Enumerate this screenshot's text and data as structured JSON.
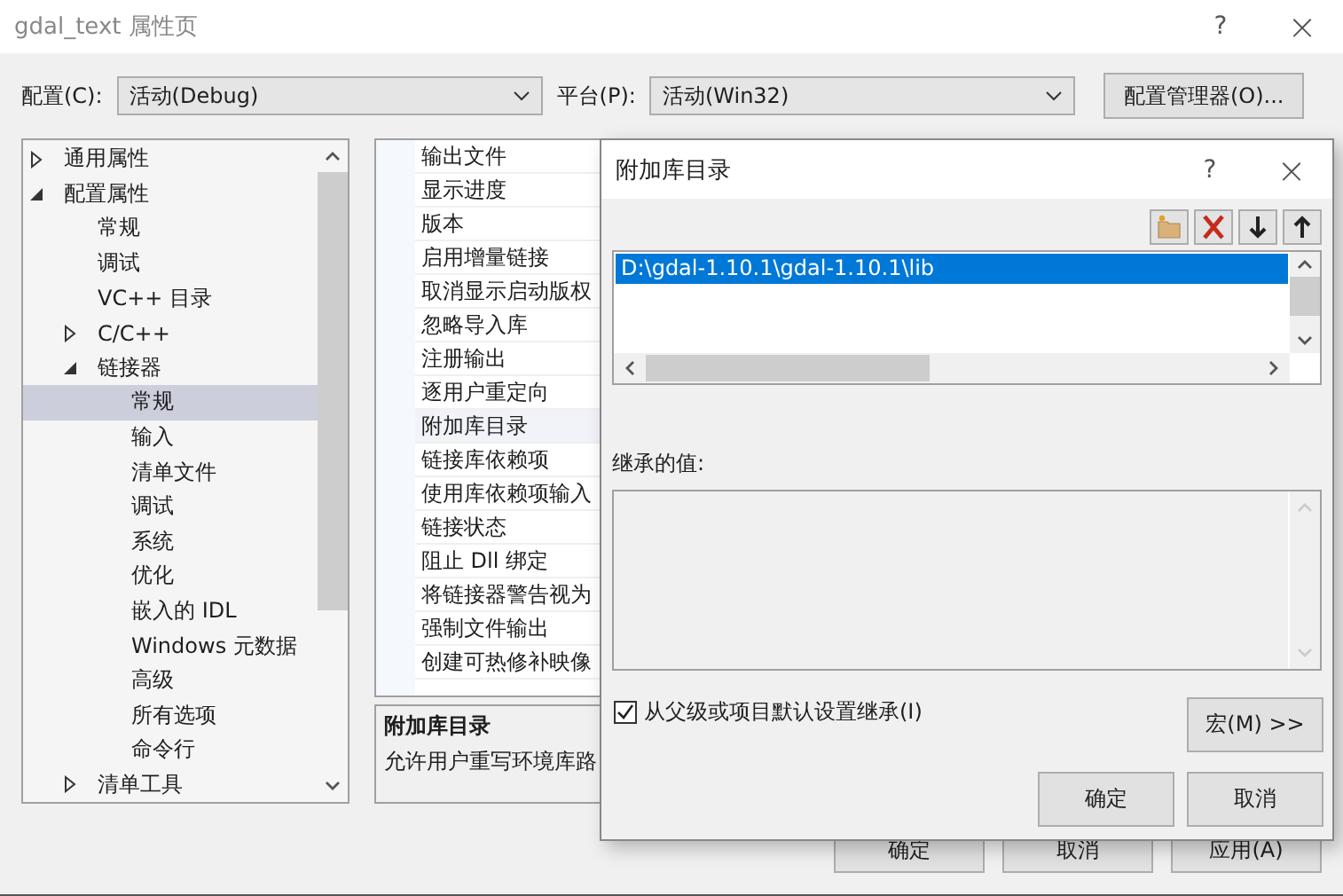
{
  "window": {
    "title": "gdal_text 属性页",
    "help": "?",
    "close": "×"
  },
  "toolbar": {
    "config_label": "配置(C):",
    "config_value": "活动(Debug)",
    "platform_label": "平台(P):",
    "platform_value": "活动(Win32)",
    "manager_button": "配置管理器(O)..."
  },
  "tree": [
    {
      "label": "通用属性",
      "expanded": false,
      "selected": false
    },
    {
      "label": "配置属性",
      "expanded": true,
      "selected": false,
      "children": [
        {
          "label": "常规",
          "selected": false
        },
        {
          "label": "调试",
          "selected": false
        },
        {
          "label": "VC++ 目录",
          "selected": false
        },
        {
          "label": "C/C++",
          "expanded": false,
          "selected": false
        },
        {
          "label": "链接器",
          "expanded": true,
          "selected": false,
          "children": [
            {
              "label": "常规",
              "selected": true
            },
            {
              "label": "输入",
              "selected": false
            },
            {
              "label": "清单文件",
              "selected": false
            },
            {
              "label": "调试",
              "selected": false
            },
            {
              "label": "系统",
              "selected": false
            },
            {
              "label": "优化",
              "selected": false
            },
            {
              "label": "嵌入的 IDL",
              "selected": false
            },
            {
              "label": "Windows 元数据",
              "selected": false
            },
            {
              "label": "高级",
              "selected": false
            },
            {
              "label": "所有选项",
              "selected": false
            },
            {
              "label": "命令行",
              "selected": false
            }
          ]
        },
        {
          "label": "清单工具",
          "expanded": false,
          "selected": false
        }
      ]
    }
  ],
  "properties": [
    {
      "name": "输出文件",
      "selected": false
    },
    {
      "name": "显示进度",
      "selected": false
    },
    {
      "name": "版本",
      "selected": false
    },
    {
      "name": "启用增量链接",
      "selected": false
    },
    {
      "name": "取消显示启动版权",
      "selected": false
    },
    {
      "name": "忽略导入库",
      "selected": false
    },
    {
      "name": "注册输出",
      "selected": false
    },
    {
      "name": "逐用户重定向",
      "selected": false
    },
    {
      "name": "附加库目录",
      "selected": true
    },
    {
      "name": "链接库依赖项",
      "selected": false
    },
    {
      "name": "使用库依赖项输入",
      "selected": false
    },
    {
      "name": "链接状态",
      "selected": false
    },
    {
      "name": "阻止 Dll 绑定",
      "selected": false
    },
    {
      "name": "将链接器警告视为",
      "selected": false
    },
    {
      "name": "强制文件输出",
      "selected": false
    },
    {
      "name": "创建可热修补映像",
      "selected": false
    }
  ],
  "description": {
    "title": "附加库目录",
    "text": "允许用户重写环境库路"
  },
  "buttons": [
    "确定",
    "取消",
    "应用(A)"
  ],
  "dialog": {
    "title": "附加库目录",
    "help": "?",
    "close": "×",
    "entries": [
      {
        "text": "D:\\gdal-1.10.1\\gdal-1.10.1\\lib",
        "selected": true
      }
    ],
    "inherited_label": "继承的值:",
    "inherit_checkbox": {
      "label": "从父级或项目默认设置继承(I)",
      "checked": true
    },
    "macro_button": "宏(M) >>",
    "buttons": [
      "确定",
      "取消"
    ]
  }
}
